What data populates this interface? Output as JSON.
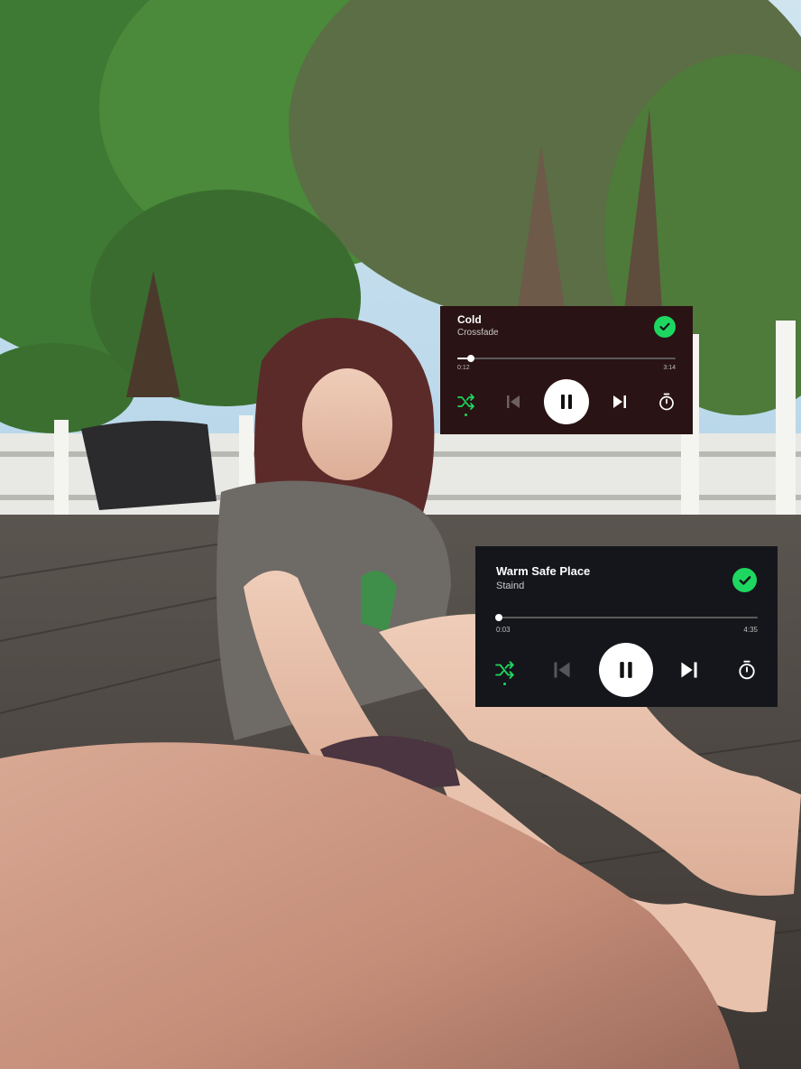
{
  "scene": {
    "description_icon": "photo-background"
  },
  "colors": {
    "accent_green": "#1ed760",
    "player1_bg": "#2a1314",
    "player2_bg": "#15161b"
  },
  "players": [
    {
      "title": "Cold",
      "artist": "Crossfade",
      "elapsed": "0:12",
      "duration": "3:14",
      "progress": 0.062,
      "saved": true
    },
    {
      "title": "Warm Safe Place",
      "artist": "Staind",
      "elapsed": "0:03",
      "duration": "4:35",
      "progress": 0.011,
      "saved": true
    }
  ],
  "icons": {
    "saved": "check-circle-icon",
    "shuffle": "shuffle-icon",
    "previous": "skip-previous-icon",
    "pause": "pause-icon",
    "next": "skip-next-icon",
    "timer": "sleep-timer-icon"
  }
}
